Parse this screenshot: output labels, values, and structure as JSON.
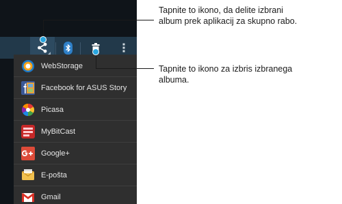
{
  "action_bar": {
    "icons": [
      "share-icon",
      "bluetooth-icon",
      "trash-icon",
      "overflow-menu-icon"
    ],
    "color": "#22394a"
  },
  "share_menu": {
    "items": [
      {
        "label": "WebStorage",
        "icon": "webstorage-icon"
      },
      {
        "label": "Facebook for ASUS Story",
        "icon": "facebook-asus-story-icon"
      },
      {
        "label": "Picasa",
        "icon": "picasa-icon"
      },
      {
        "label": "MyBitCast",
        "icon": "mybitcast-icon"
      },
      {
        "label": "Google+",
        "icon": "google-plus-icon"
      },
      {
        "label": "E-pošta",
        "icon": "email-icon"
      },
      {
        "label": "Gmail",
        "icon": "gmail-icon"
      }
    ]
  },
  "callouts": {
    "share": {
      "line1": "Tapnite to ikono, da delite izbrani",
      "line2": "album prek aplikacij za skupno rabo."
    },
    "delete": {
      "line1": "Tapnite to ikono za izbris izbranega",
      "line2": "albuma."
    }
  },
  "colors": {
    "callout_dot": "#29a6e0"
  }
}
